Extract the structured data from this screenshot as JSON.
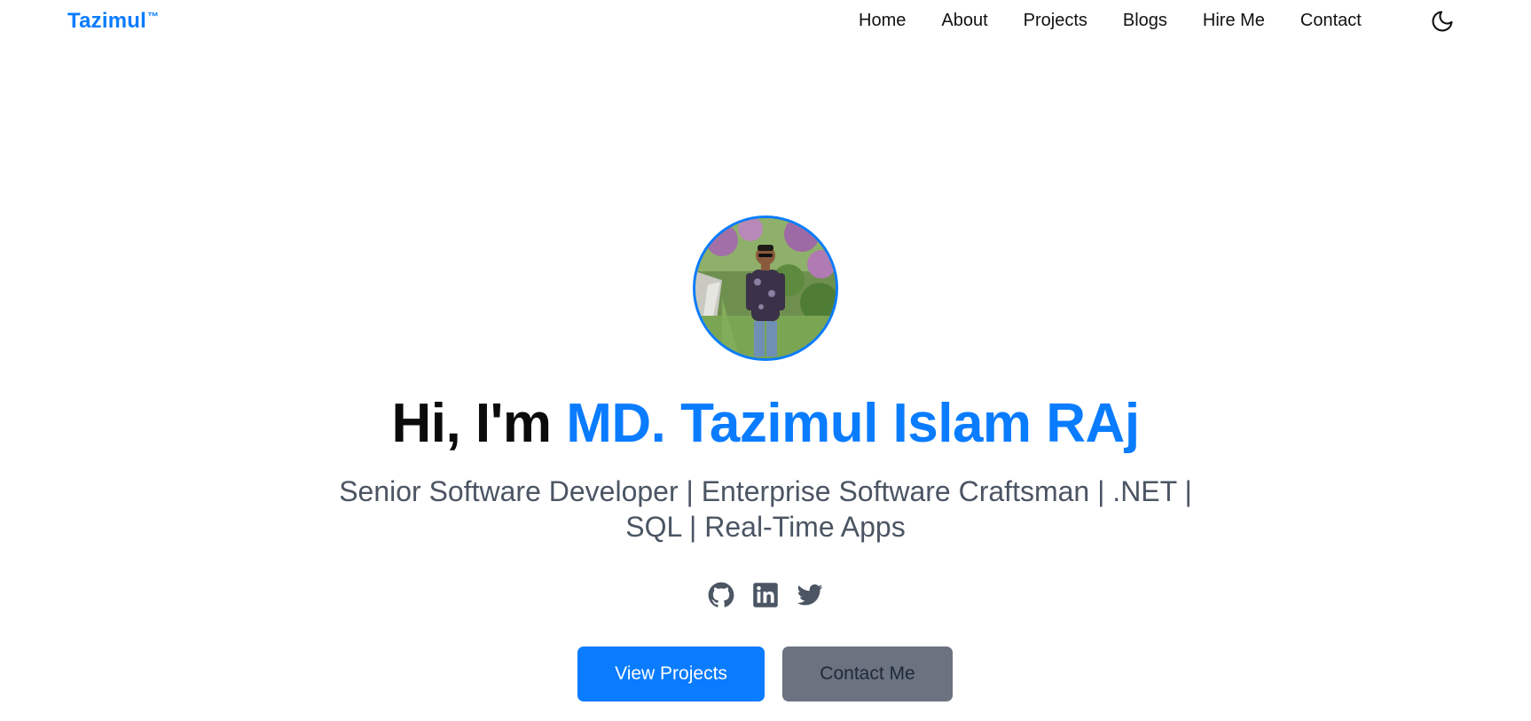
{
  "brand": {
    "name": "Tazimul",
    "trademark": "™"
  },
  "nav": {
    "items": [
      {
        "label": "Home"
      },
      {
        "label": "About"
      },
      {
        "label": "Projects"
      },
      {
        "label": "Blogs"
      },
      {
        "label": "Hire Me"
      },
      {
        "label": "Contact"
      }
    ],
    "theme_toggle_icon": "moon-icon"
  },
  "hero": {
    "avatar_icon": "profile-photo",
    "greeting": "Hi, I'm ",
    "name": "MD. Tazimul Islam RAj",
    "subtitle_line1": "Senior Software Developer | Enterprise Software Craftsman | .NET |",
    "subtitle_line2": "SQL | Real-Time Apps",
    "socials": [
      {
        "icon": "github-icon"
      },
      {
        "icon": "linkedin-icon"
      },
      {
        "icon": "twitter-icon"
      }
    ],
    "primary_button": "View Projects",
    "secondary_button": "Contact Me"
  },
  "colors": {
    "accent": "#0a7cff",
    "text": "#0b0b0b",
    "muted": "#4b5563",
    "secondary_button": "#6b7280"
  }
}
